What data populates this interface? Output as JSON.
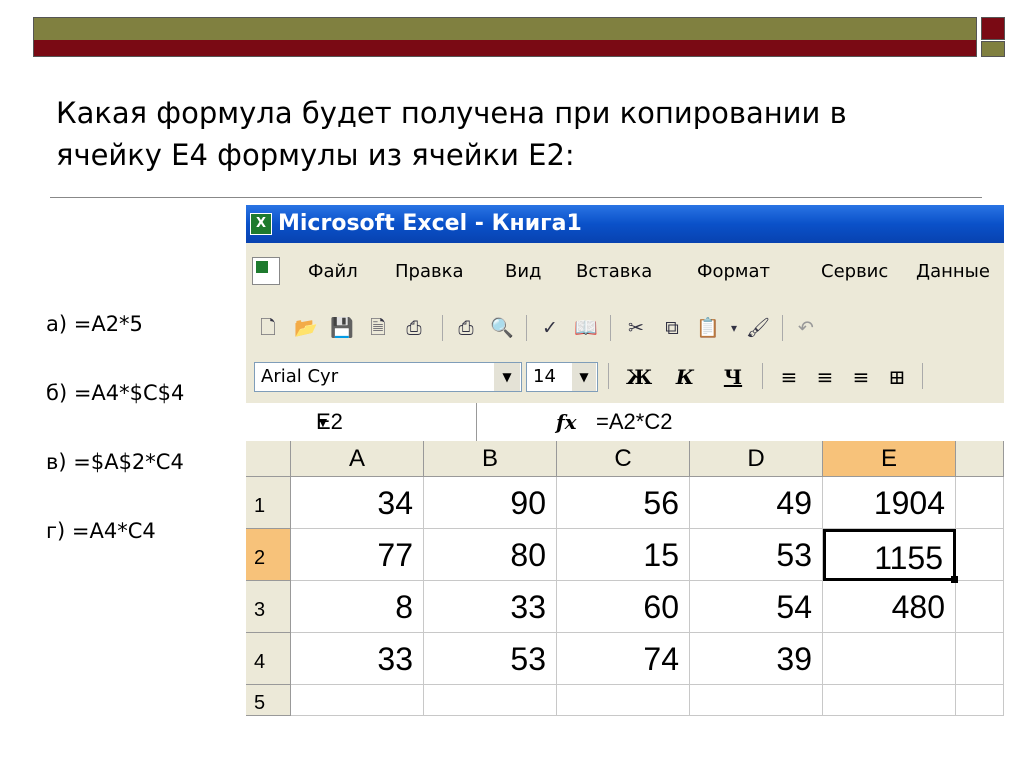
{
  "slide": {
    "question": "Какая формула будет получена при копировании в ячейку Е4 формулы из ячейки Е2:",
    "answers": [
      "а) =А2*5",
      "б) =А4*$С$4",
      "в) =$А$2*С4",
      "г) =А4*С4"
    ]
  },
  "excel": {
    "icon": "excel-app-icon",
    "title": "Microsoft Excel - Книга1",
    "menu": [
      "Файл",
      "Правка",
      "Вид",
      "Вставка",
      "Формат",
      "Сервис",
      "Данные"
    ],
    "toolbar_icons": [
      "new-document-icon",
      "open-folder-icon",
      "save-icon",
      "permission-icon",
      "print-icon",
      "print-preview-icon",
      "spelling-icon",
      "research-icon",
      "cut-icon",
      "copy-icon",
      "paste-icon",
      "format-painter-icon",
      "undo-icon"
    ],
    "font_name": "Arial Cyr",
    "font_size": "14",
    "bold_label": "Ж",
    "italic_label": "К",
    "underline_label": "Ч",
    "name_box": "E2",
    "fx_label": "fx",
    "formula": "=A2*C2",
    "columns": [
      "A",
      "B",
      "C",
      "D",
      "E"
    ],
    "selected_column": "E",
    "selected_row": "2",
    "rows": [
      {
        "header": "1",
        "cells": [
          "34",
          "90",
          "56",
          "49",
          "1904"
        ]
      },
      {
        "header": "2",
        "cells": [
          "77",
          "80",
          "15",
          "53",
          "1155"
        ]
      },
      {
        "header": "3",
        "cells": [
          "8",
          "33",
          "60",
          "54",
          "480"
        ]
      },
      {
        "header": "4",
        "cells": [
          "33",
          "53",
          "74",
          "39",
          ""
        ]
      },
      {
        "header": "5",
        "cells": [
          "",
          "",
          "",
          "",
          ""
        ]
      }
    ],
    "colors": {
      "titlebar": "#0a51c9",
      "active_header": "#f7c27a",
      "chrome": "#ece9d8"
    }
  }
}
